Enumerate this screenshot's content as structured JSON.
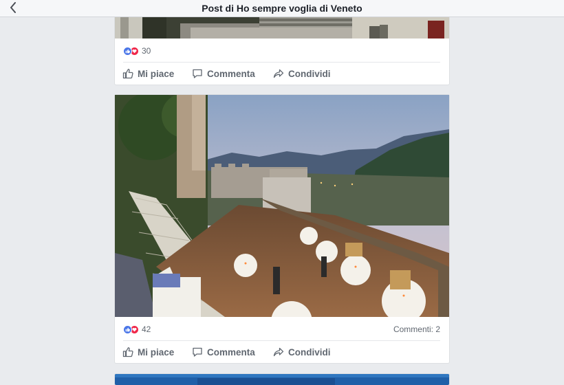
{
  "header": {
    "title": "Post di Ho sempre voglia di Veneto",
    "back_icon": "chevron-left-icon"
  },
  "posts": [
    {
      "reactions": [
        "like",
        "love"
      ],
      "reaction_count": "30",
      "comments": "",
      "actions": {
        "like": "Mi piace",
        "comment": "Commenta",
        "share": "Condividi"
      }
    },
    {
      "reactions": [
        "like",
        "love"
      ],
      "reaction_count": "42",
      "comments": "Commenti: 2",
      "actions": {
        "like": "Mi piace",
        "comment": "Commenta",
        "share": "Condividi"
      }
    }
  ],
  "colors": {
    "like": "#4a76e8",
    "love": "#f0284a",
    "text_muted": "#606770",
    "background": "#e9ebee"
  }
}
